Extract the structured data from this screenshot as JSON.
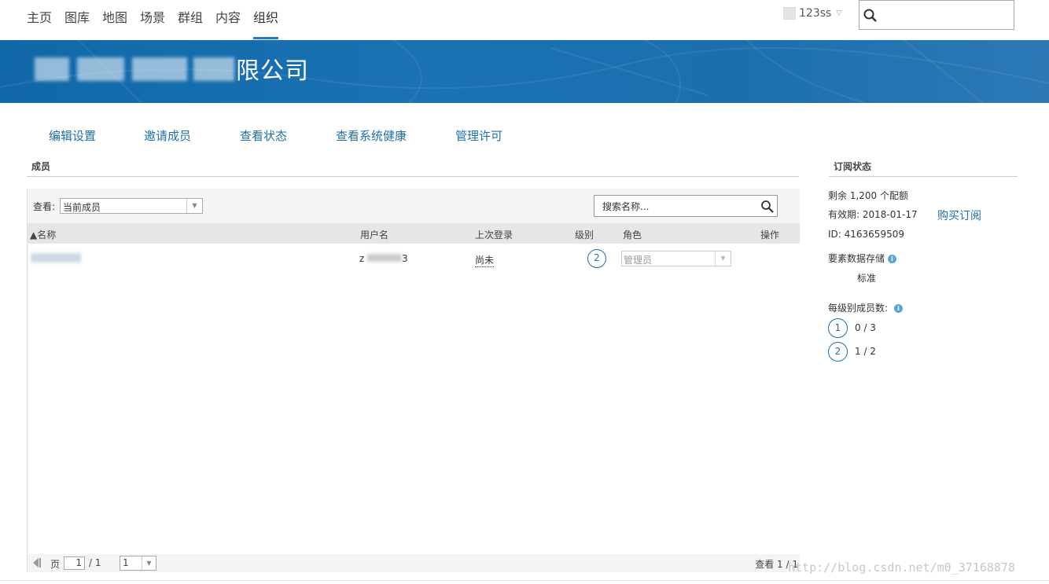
{
  "nav": {
    "items": [
      "主页",
      "图库",
      "地图",
      "场景",
      "群组",
      "内容",
      "组织"
    ],
    "active": "组织",
    "user": "123ss",
    "search_placeholder": ""
  },
  "banner": {
    "title_visible": "限公司",
    "color": "#1a6fb0"
  },
  "actions": [
    "编辑设置",
    "邀请成员",
    "查看状态",
    "查看系统健康",
    "管理许可"
  ],
  "members": {
    "section_title": "成员",
    "view_label": "查看:",
    "view_value": "当前成员",
    "search_placeholder": "搜索名称...",
    "columns": {
      "name": "▲名称",
      "username": "用户名",
      "last_login": "上次登录",
      "level": "级别",
      "role": "角色",
      "actions": "操作"
    },
    "rows": [
      {
        "username_prefix": "z",
        "username_suffix": "3",
        "last_login": "尚未",
        "level": "2",
        "role": "管理员"
      }
    ],
    "pager": {
      "page_label": "页",
      "page_value": "1",
      "page_total": "/ 1",
      "page_size": "1",
      "summary": "查看 1 / 1"
    }
  },
  "subscription": {
    "title": "订阅状态",
    "remaining": "剩余 1,200 个配额",
    "expiry": "有效期: 2018-01-17",
    "buy_link": "购买订阅",
    "id": "ID: 4163659509",
    "storage_label": "要素数据存储",
    "storage_value": "标准",
    "members_per_level_label": "每级别成员数:",
    "levels": [
      {
        "level": "1",
        "count": "0 / 3"
      },
      {
        "level": "2",
        "count": "1 / 2"
      }
    ]
  },
  "watermark": "http://blog.csdn.net/m0_37168878",
  "colors": {
    "accent": "#1f6fa8",
    "banner": "#1a6fb0",
    "info": "#5aa4da"
  }
}
